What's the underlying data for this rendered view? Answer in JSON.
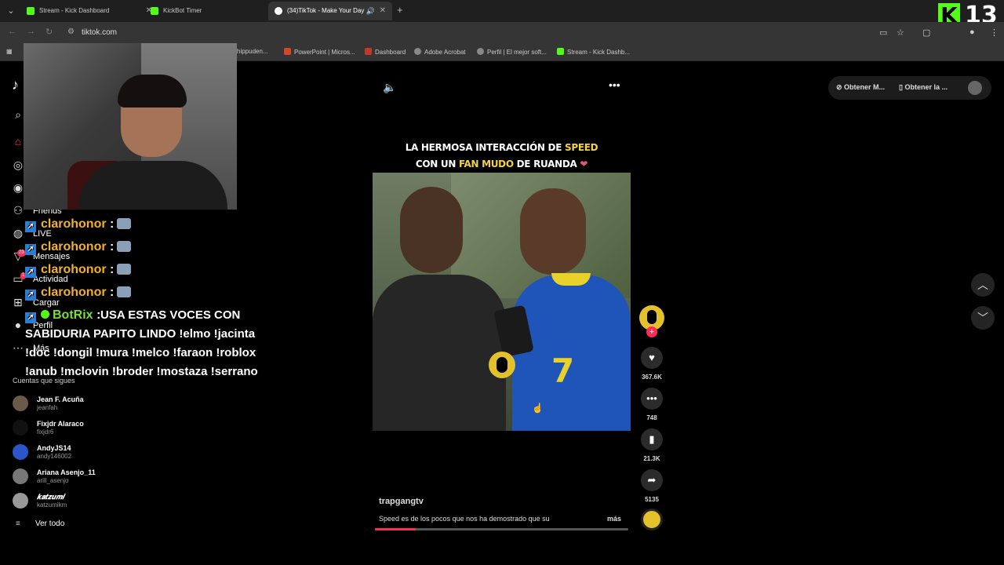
{
  "browser": {
    "tabs": [
      {
        "title": "Stream - Kick Dashboard"
      },
      {
        "title": "KickBot Timer"
      },
      {
        "title": "(34)TikTok - Make Your Day"
      }
    ],
    "url": "tiktok.com",
    "bookmarks": [
      "hippuden...",
      "PowerPoint | Micros...",
      "Dashboard",
      "Adobe Acrobat",
      "Perfil | El mejor soft...",
      "Stream - Kick Dashb..."
    ]
  },
  "overlay": {
    "kick_count": "13"
  },
  "sidebar": {
    "labels": [
      "Friends",
      "LIVE",
      "Mensajes",
      "Actividad",
      "Cargar",
      "Perfil",
      "Más"
    ],
    "badges": [
      "23",
      "1"
    ],
    "following_header": "Cuentas que sigues",
    "accounts": [
      {
        "name": "Jean F. Acuña",
        "handle": "jeanfah"
      },
      {
        "name": "Fixjdr Alaraco",
        "handle": "fixjdr6"
      },
      {
        "name": "AndyJS14",
        "handle": "andy146002"
      },
      {
        "name": "Ariana Asenjo_11",
        "handle": "arill_asenjo"
      },
      {
        "name": "𝒌𝒂𝒕𝒛𝒖𝒎𝒊",
        "handle": "katzumikm"
      }
    ],
    "see_all": "Ver todo"
  },
  "chat": {
    "messages": [
      {
        "user": "clarohonor",
        "sep": ":"
      },
      {
        "user": "clarohonor",
        "sep": ":"
      },
      {
        "user": "clarohonor",
        "sep": ":"
      },
      {
        "user": "clarohonor",
        "sep": ":"
      }
    ],
    "bot": {
      "user": "BotRix",
      "sep": ":",
      "text": "USA ESTAS VOCES CON SABIDURIA PAPITO LINDO !elmo !jacinta !doc !dongil !mura !melco !faraon !roblox !anub !mclovin !broder !mostaza !serrano"
    }
  },
  "video": {
    "caption_line1_a": "LA HERMOSA INTERACCIÓN DE",
    "caption_line1_b": "SPEED",
    "caption_line2_a": "CON UN",
    "caption_line2_b": "FAN MUDO",
    "caption_line2_c": "DE RUANDA",
    "caption_heart": "❤",
    "jersey_number": "7",
    "author": "trapgangtv",
    "description": "Speed es de los pocos que nos ha demostrado que su",
    "more": "más",
    "progress": 0.16
  },
  "actions": {
    "likes": "367.6K",
    "comments": "748",
    "saves": "21.3K",
    "shares": "5135"
  },
  "topright": {
    "get_app1": "Obtener M...",
    "get_app2": "Obtener la ..."
  },
  "colors": {
    "tiktok_red": "#fe2c55",
    "kick_green": "#53fc18",
    "chat_user": "#f2b12b",
    "chat_bot": "#7cdc3a",
    "caption_highlight": "#f5d33a"
  },
  "icons": [
    "search-icon",
    "home-icon",
    "explore-icon",
    "friends-icon",
    "live-icon",
    "messages-icon",
    "activity-icon",
    "upload-icon",
    "profile-icon",
    "more-icon",
    "volume-icon",
    "options-icon",
    "like-icon",
    "comment-icon",
    "bookmark-icon",
    "share-icon",
    "chevron-up-icon",
    "chevron-down-icon"
  ]
}
